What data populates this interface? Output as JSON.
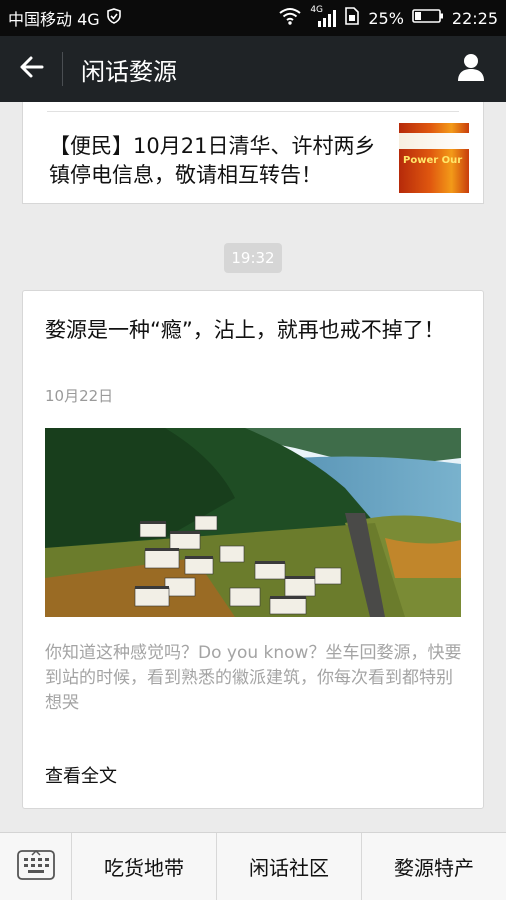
{
  "status_bar": {
    "carrier": "中国移动 4G",
    "network_small": "4G",
    "battery": "25%",
    "time": "22:25"
  },
  "nav": {
    "title": "闲话婺源"
  },
  "messages": [
    {
      "title": "【便民】10月21日清华、许村两乡镇停电信息，敬请相互转告！",
      "thumb_caption": "Power Our"
    },
    {
      "time": "19:32",
      "title": "婺源是一种“瘾”，沾上，就再也戒不掉了！",
      "date": "10月22日",
      "excerpt": "你知道这种感觉吗？Do you know？坐车回婺源，快要到站的时候，看到熟悉的徽派建筑，你每次看到都特别想哭",
      "read_more": "查看全文"
    }
  ],
  "bottom_menu": {
    "items": [
      "吃货地带",
      "闲话社区",
      "婺源特产"
    ]
  }
}
